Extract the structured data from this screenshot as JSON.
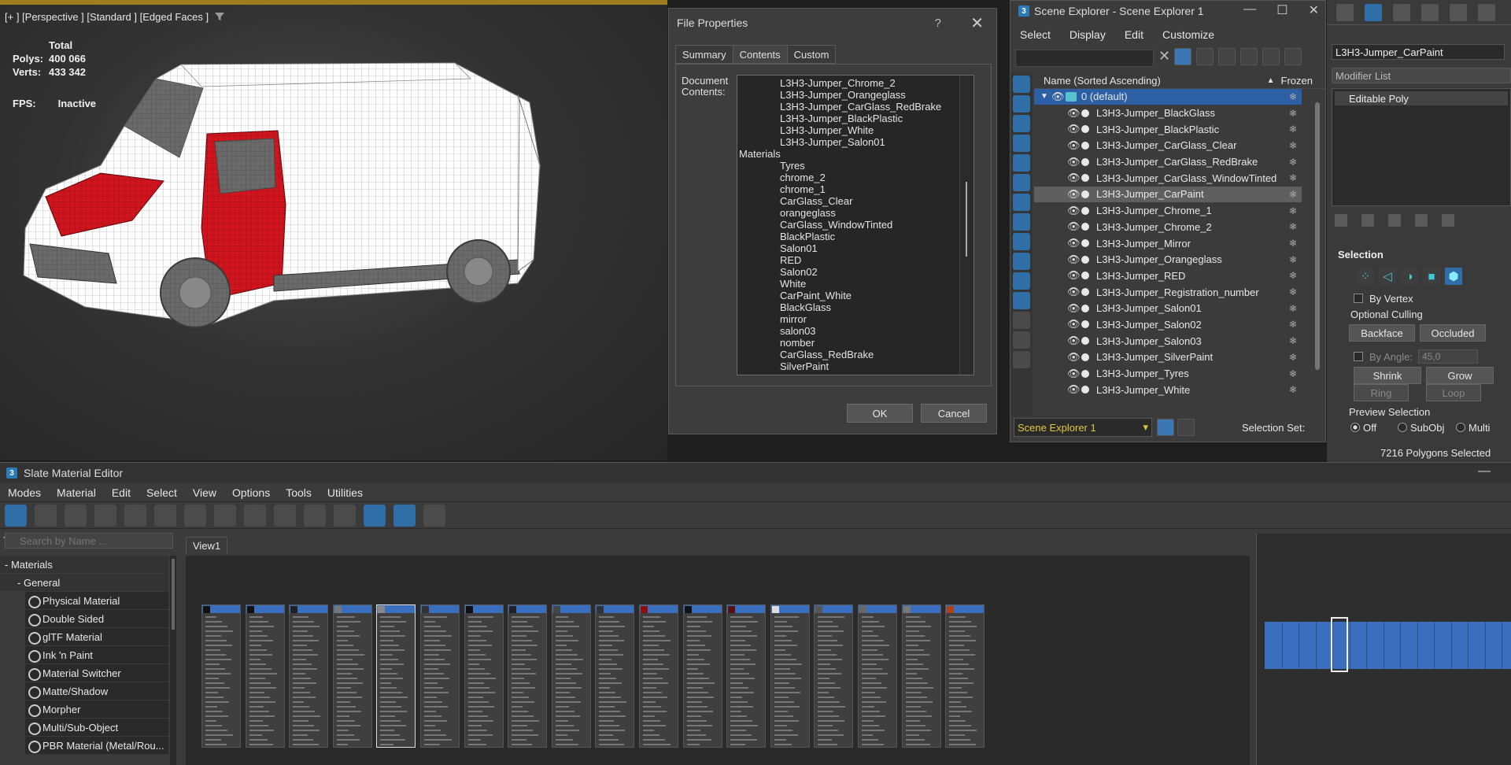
{
  "viewport": {
    "label": "[+ ] [Perspective ] [Standard ] [Edged Faces ]",
    "stats": {
      "total_label": "Total",
      "polys_label": "Polys:",
      "polys_value": "400 066",
      "verts_label": "Verts:",
      "verts_value": "433 342",
      "fps_label": "FPS:",
      "fps_value": "Inactive"
    }
  },
  "file_properties": {
    "title": "File Properties",
    "help": "?",
    "close": "✕",
    "tabs": [
      "Summary",
      "Contents",
      "Custom"
    ],
    "active_tab": "Contents",
    "doc_label": "Document Contents:",
    "lines": [
      {
        "text": "L3H3-Jumper_Chrome_2",
        "indent": true
      },
      {
        "text": "L3H3-Jumper_Orangeglass",
        "indent": true
      },
      {
        "text": "L3H3-Jumper_CarGlass_RedBrake",
        "indent": true
      },
      {
        "text": "L3H3-Jumper_BlackPlastic",
        "indent": true
      },
      {
        "text": "L3H3-Jumper_White",
        "indent": true
      },
      {
        "text": "L3H3-Jumper_Salon01",
        "indent": true
      },
      {
        "text": "Materials",
        "indent": false
      },
      {
        "text": "Tyres",
        "indent": true
      },
      {
        "text": "chrome_2",
        "indent": true
      },
      {
        "text": "chrome_1",
        "indent": true
      },
      {
        "text": "CarGlass_Clear",
        "indent": true
      },
      {
        "text": "orangeglass",
        "indent": true
      },
      {
        "text": "CarGlass_WindowTinted",
        "indent": true
      },
      {
        "text": "BlackPlastic",
        "indent": true
      },
      {
        "text": "Salon01",
        "indent": true
      },
      {
        "text": "RED",
        "indent": true
      },
      {
        "text": "Salon02",
        "indent": true
      },
      {
        "text": "White",
        "indent": true
      },
      {
        "text": "CarPaint_White",
        "indent": true
      },
      {
        "text": "BlackGlass",
        "indent": true
      },
      {
        "text": "mirror",
        "indent": true
      },
      {
        "text": "salon03",
        "indent": true
      },
      {
        "text": "nomber",
        "indent": true
      },
      {
        "text": "CarGlass_RedBrake",
        "indent": true
      },
      {
        "text": "SilverPaint",
        "indent": true
      }
    ],
    "ok_label": "OK",
    "cancel_label": "Cancel"
  },
  "scene_explorer": {
    "title": "Scene Explorer - Scene Explorer 1",
    "app_icon": "3",
    "win_buttons": [
      "—",
      "☐",
      "✕"
    ],
    "menu": [
      "Select",
      "Display",
      "Edit",
      "Customize"
    ],
    "search_clear": "✕",
    "col_name": "Name (Sorted Ascending)",
    "col_sort_arrow": "▲",
    "col_frozen": "Frozen",
    "layer_name": "0 (default)",
    "rows": [
      "L3H3-Jumper_BlackGlass",
      "L3H3-Jumper_BlackPlastic",
      "L3H3-Jumper_CarGlass_Clear",
      "L3H3-Jumper_CarGlass_RedBrake",
      "L3H3-Jumper_CarGlass_WindowTinted",
      "L3H3-Jumper_CarPaint",
      "L3H3-Jumper_Chrome_1",
      "L3H3-Jumper_Chrome_2",
      "L3H3-Jumper_Mirror",
      "L3H3-Jumper_Orangeglass",
      "L3H3-Jumper_RED",
      "L3H3-Jumper_Registration_number",
      "L3H3-Jumper_Salon01",
      "L3H3-Jumper_Salon02",
      "L3H3-Jumper_Salon03",
      "L3H3-Jumper_SilverPaint",
      "L3H3-Jumper_Tyres",
      "L3H3-Jumper_White"
    ],
    "selected_row": "L3H3-Jumper_CarPaint",
    "explorer_dropdown": "Scene Explorer 1",
    "selection_set_label": "Selection Set:",
    "eye_glyph": "👁",
    "freeze_glyph": "❄"
  },
  "command_panel": {
    "object_name": "L3H3-Jumper_CarPaint",
    "modifier_list": "Modifier List",
    "stack_item": "Editable Poly",
    "selection_title": "Selection",
    "by_vertex": "By Vertex",
    "optional_culling": "Optional Culling",
    "backface": "Backface",
    "occluded": "Occluded",
    "by_angle": "By Angle:",
    "angle_value": "45,0",
    "shrink": "Shrink",
    "grow": "Grow",
    "ring": "Ring",
    "loop": "Loop",
    "preview_selection": "Preview Selection",
    "preview_off": "Off",
    "preview_subobj": "SubObj",
    "preview_multi": "Multi",
    "status": "7216 Polygons Selected"
  },
  "slate": {
    "title": "Slate Material Editor",
    "minimize": "—",
    "menu": [
      "Modes",
      "Material",
      "Edit",
      "Select",
      "View",
      "Options",
      "Tools",
      "Utilities"
    ],
    "search_placeholder": "Search by Name ...",
    "tree": {
      "materials": "Materials",
      "general": "General",
      "items": [
        "Physical Material",
        "Double Sided",
        "glTF Material",
        "Ink 'n Paint",
        "Material Switcher",
        "Matte/Shadow",
        "Morpher",
        "Multi/Sub-Object",
        "PBR Material (Metal/Rou..."
      ]
    },
    "view_tab": "View1",
    "node_count": 18,
    "selected_node": 4
  },
  "colors": {
    "accent_blue": "#2f6ea6",
    "selection_red": "#d0141e",
    "scene_dropdown_text": "#e2c83a"
  }
}
